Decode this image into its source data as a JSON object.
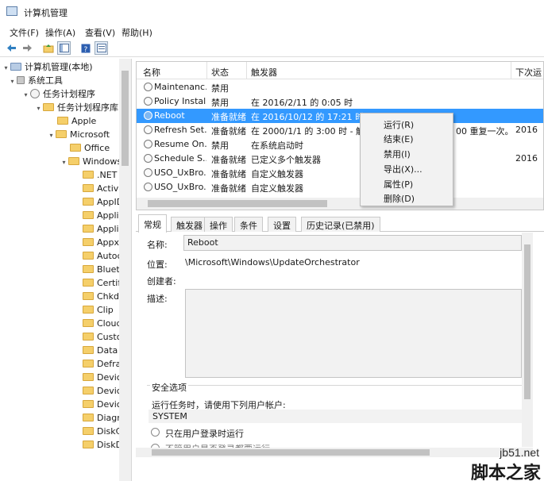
{
  "window": {
    "title": "计算机管理"
  },
  "menu": [
    "文件(F)",
    "操作(A)",
    "查看(V)",
    "帮助(H)"
  ],
  "toolbar": {
    "icons": [
      "back-arrow-icon",
      "forward-arrow-icon",
      "up-folder-icon",
      "show-tree-icon",
      "help-icon",
      "properties-icon"
    ]
  },
  "tree": {
    "root": "计算机管理(本地)",
    "system_tools": "系统工具",
    "scheduler": "任务计划程序",
    "library": "任务计划程序库",
    "apple": "Apple",
    "microsoft": "Microsoft",
    "office": "Office",
    "windows": "Windows",
    "children": [
      ".NET",
      "Active",
      "AppID",
      "Applic",
      "Applic",
      "Appx",
      "Autoc",
      "Blueto",
      "Certif",
      "Chkd",
      "Clip",
      "Cloud",
      "Custo",
      "Data",
      "Defra",
      "Devic",
      "Devic",
      "Devic",
      "Diagr",
      "DiskC",
      "DiskD"
    ]
  },
  "list": {
    "headers": [
      "名称",
      "状态",
      "触发器",
      "下次运"
    ],
    "rows": [
      {
        "name": "Maintenanc...",
        "status": "禁用",
        "trigger": "",
        "next": ""
      },
      {
        "name": "Policy Install",
        "status": "禁用",
        "trigger": "在 2016/2/11 的 0:05 时",
        "next": ""
      },
      {
        "name": "Reboot",
        "status": "准备就绪",
        "trigger": "在 2016/10/12 的 17:21 时",
        "next": ""
      },
      {
        "name": "Refresh Set...",
        "status": "准备就绪",
        "trigger": "在 2000/1/1 的 3:00 时 - 触发",
        "next": "2016"
      },
      {
        "name": "Resume On...",
        "status": "禁用",
        "trigger": "在系统启动时",
        "next": ""
      },
      {
        "name": "Schedule S...",
        "status": "准备就绪",
        "trigger": "已定义多个触发器",
        "next": "2016"
      },
      {
        "name": "USO_UxBro...",
        "status": "准备就绪",
        "trigger": "自定义触发器",
        "next": ""
      },
      {
        "name": "USO_UxBro...",
        "status": "准备就绪",
        "trigger": "自定义触发器",
        "next": ""
      }
    ],
    "trigger_overflow": "00 重复一次。"
  },
  "context_menu": [
    "运行(R)",
    "结束(E)",
    "禁用(I)",
    "导出(X)...",
    "属性(P)",
    "删除(D)"
  ],
  "detail": {
    "tabs": [
      "常规",
      "触发器",
      "操作",
      "条件",
      "设置",
      "历史记录(已禁用)"
    ],
    "name_label": "名称:",
    "name_value": "Reboot",
    "location_label": "位置:",
    "location_value": "\\Microsoft\\Windows\\UpdateOrchestrator",
    "author_label": "创建者:",
    "desc_label": "描述:",
    "security_title": "安全选项",
    "run_as_label": "运行任务时，请使用下列用户帐户:",
    "account": "SYSTEM",
    "radio1": "只在用户登录时运行",
    "radio2": "不管用户是否登录都要运行"
  },
  "watermark": {
    "url": "jb51.net",
    "text": "脚本之家"
  },
  "colors": {
    "selection": "#3399ff",
    "accent_band": "#c0392b"
  }
}
